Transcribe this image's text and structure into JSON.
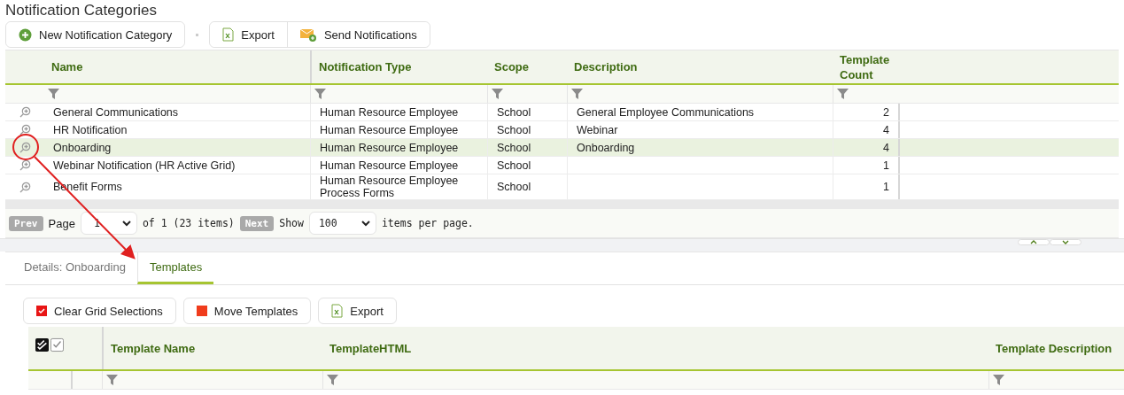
{
  "page": {
    "title": "Notification Categories"
  },
  "toolbar": [
    {
      "kind": "add",
      "label": "New Notification Category"
    },
    {
      "kind": "export",
      "label": "Export"
    },
    {
      "kind": "send",
      "label": "Send Notifications"
    }
  ],
  "categories_grid": {
    "columns": [
      "Name",
      "Notification Type",
      "Scope",
      "Description",
      "Template Count"
    ],
    "rows": [
      {
        "name": "General Communications",
        "type": "Human Resource Employee",
        "scope": "School",
        "description": "General Employee Communications",
        "template_count": "2",
        "selected": false
      },
      {
        "name": "HR Notification",
        "type": "Human Resource Employee",
        "scope": "School",
        "description": "Webinar",
        "template_count": "4",
        "selected": false
      },
      {
        "name": "Onboarding",
        "type": "Human Resource Employee",
        "scope": "School",
        "description": "Onboarding",
        "template_count": "4",
        "selected": true
      },
      {
        "name": "Webinar Notification (HR Active Grid)",
        "type": "Human Resource Employee",
        "scope": "School",
        "description": "",
        "template_count": "1",
        "selected": false
      },
      {
        "name": "Benefit Forms",
        "type": "Human Resource Employee Process Forms",
        "scope": "School",
        "description": "",
        "template_count": "1",
        "selected": false
      }
    ]
  },
  "pager": {
    "prev": "Prev",
    "page_label": "Page",
    "page": "1",
    "of_text": "of 1 (23 items)",
    "next": "Next",
    "show": "Show",
    "per_page": "100",
    "per_page_suffix": "items per page."
  },
  "tabs": [
    {
      "label": "Details: Onboarding",
      "selected": false
    },
    {
      "label": "Templates",
      "selected": true
    }
  ],
  "template_toolbar": [
    {
      "kind": "clear",
      "label": "Clear Grid Selections"
    },
    {
      "kind": "move",
      "label": "Move Templates"
    },
    {
      "kind": "export",
      "label": "Export"
    }
  ],
  "templates_grid": {
    "columns": [
      "Template Name",
      "TemplateHTML",
      "Template Description"
    ]
  }
}
